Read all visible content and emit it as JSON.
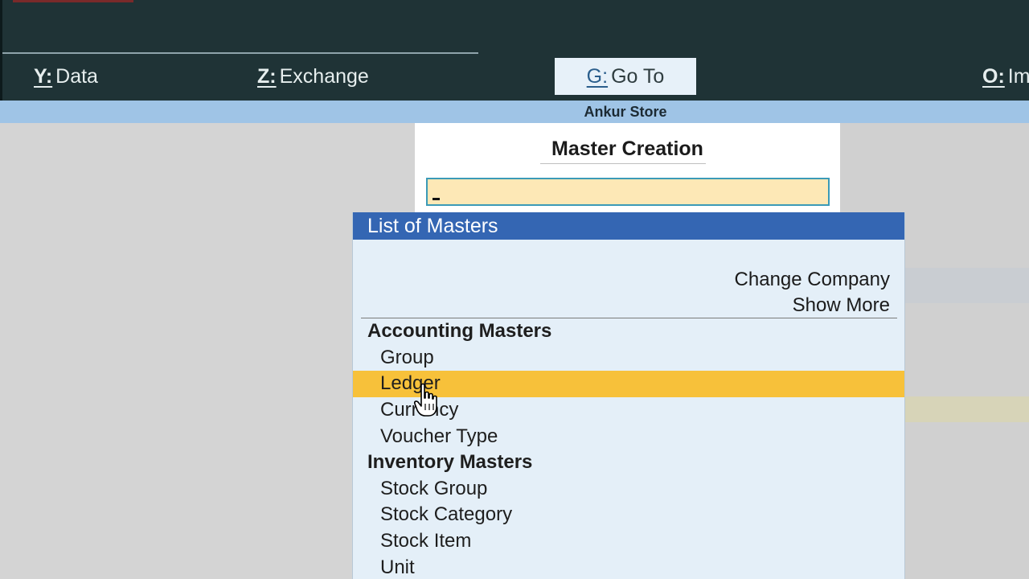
{
  "menu": {
    "data": {
      "key": "Y:",
      "label": "Data"
    },
    "exchange": {
      "key": "Z:",
      "label": "Exchange"
    },
    "goto": {
      "key": "G:",
      "label": "Go To"
    },
    "import": {
      "key": "O:",
      "label": "Im"
    }
  },
  "company_name": "Ankur Store",
  "master_creation": {
    "title": "Master Creation",
    "input_value": ""
  },
  "list_of_masters": {
    "title": "List of Masters",
    "options": [
      "Change Company",
      "Show More"
    ],
    "groups": [
      {
        "heading": "Accounting Masters",
        "items": [
          "Group",
          "Ledger",
          "Currency",
          "Voucher Type"
        ]
      },
      {
        "heading": "Inventory Masters",
        "items": [
          "Stock Group",
          "Stock Category",
          "Stock Item",
          "Unit"
        ]
      }
    ],
    "selected_item": "Ledger"
  },
  "colors": {
    "topbar": "#1f3336",
    "company_bar": "#9fc4e6",
    "list_header": "#3466b3",
    "selection": "#f7c13a",
    "input_bg": "#fde8b6"
  },
  "icons": {
    "mouse_cursor": "hand-pointer-icon"
  }
}
